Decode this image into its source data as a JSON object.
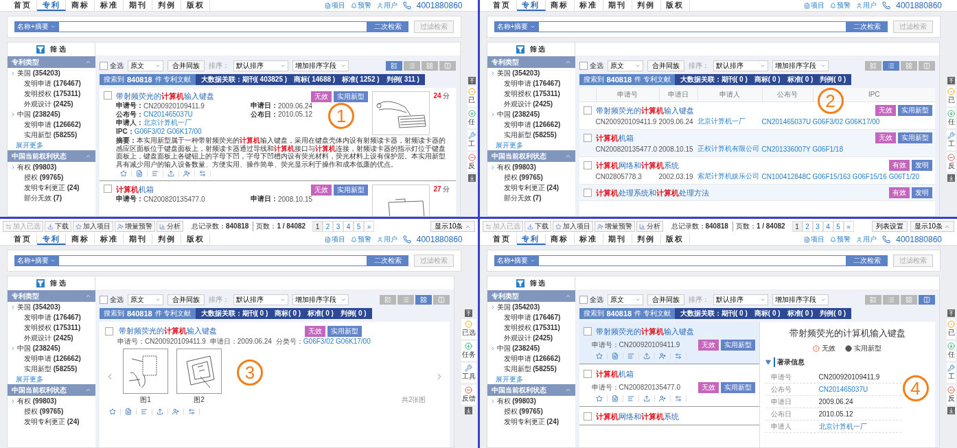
{
  "panels": [
    {
      "marker": "1",
      "nav": {
        "tabs": [
          {
            "label": "首页",
            "selected": false
          },
          {
            "label": "专利",
            "selected": true
          },
          {
            "label": "商标",
            "selected": false
          },
          {
            "label": "标准",
            "selected": false
          },
          {
            "label": "期刊",
            "selected": false
          },
          {
            "label": "判例",
            "selected": false
          },
          {
            "label": "版权",
            "selected": false
          }
        ],
        "links": [
          "项目",
          "预警",
          "用户"
        ],
        "phone": "4001880860"
      },
      "search": {
        "field": "名称+摘要",
        "button": "二次检索",
        "filter": {
          "label": "过滤检索",
          "disabled": true
        }
      },
      "filter_title": "筛 选",
      "sidebar": [
        {
          "title": "专利类型",
          "items": [
            {
              "label": "美国",
              "count": "(354203)",
              "children": [
                {
                  "label": "发明申请",
                  "count": "(176467)"
                },
                {
                  "label": "发明授权",
                  "count": "(175311)"
                },
                {
                  "label": "外观设计",
                  "count": "(2425)"
                }
              ]
            },
            {
              "label": "中国",
              "count": "(238245)",
              "children": [
                {
                  "label": "发明申请",
                  "count": "(126662)"
                },
                {
                  "label": "实用新型",
                  "count": "(58255)"
                }
              ]
            }
          ],
          "more": "展开更多"
        },
        {
          "title": "中国当前权利状态",
          "items": [
            {
              "label": "有权",
              "count": "(99803)",
              "children": [
                {
                  "label": "授权",
                  "count": "(99765)"
                },
                {
                  "label": "发明专利更正",
                  "count": "(24)"
                },
                {
                  "label": "部分无效",
                  "count": "(7)"
                }
              ]
            }
          ]
        }
      ],
      "toolbar": {
        "select_all": {
          "label": "全选",
          "checked": false
        },
        "source": "原文",
        "merge": "合并同族",
        "sort_label": "排序：",
        "sort": "默认排序",
        "add_sort": "增加排序字段",
        "views": [
          {
            "selected": true
          },
          {
            "selected": false
          },
          {
            "selected": false
          },
          {
            "selected": false
          }
        ]
      },
      "summary": {
        "found_label": "搜索到",
        "found": "840818",
        "found_unit": "件 专利文献",
        "related_label": "大数据关联：",
        "related": [
          "期刊( 403825 )",
          "商标( 14688 )",
          "标准( 1252 )",
          "判例( 311 )"
        ]
      },
      "results": [
        {
          "title": "带射频荧光的**计算机**输入键盘",
          "checked": false,
          "tags": [
            {
              "label": "无效",
              "kind": "status"
            },
            {
              "label": "实用新型",
              "kind": "type"
            }
          ],
          "fields": [
            {
              "label": "申请号：",
              "value": "CN200920109411.9",
              "link": false
            },
            {
              "label": "公布号：",
              "value": "CN201465037U",
              "link": true
            },
            {
              "label": "申请人：",
              "value": "北京计算机一厂",
              "link": true
            },
            {
              "label": "IPC：",
              "value": "G06F3/02  G06K17/00",
              "link": true
            }
          ],
          "fields_right": [
            {
              "label": "申请日：",
              "value": "2009.06.24",
              "link": false
            },
            {
              "label": "公布日：",
              "value": "2010.05.12",
              "link": false
            }
          ],
          "abstract_label": "摘要：",
          "abstract": "本实用新型属于一种带射频荧光的**计算机**输入键盘，采用在键盘壳体内设有射频读卡器，射频读卡器的感应区面板位于键盘面板上，射频读卡器通过导线和**计算机**接口与**计算机**连接，射频读卡器的指示灯位于键盘面板上，键盘面板上各键钮上的字母下凹，字母下凹槽内设有荧光材料，荧光材料上设有保护层。本实用新型具有减少用户的输入设备数量、方便实用、操作简单、荧光显示利于操作和成本低廉的优点。",
          "score": "24",
          "score_unit": "分"
        },
        {
          "title": "**计算机**机箱",
          "checked": false,
          "tags": [
            {
              "label": "无效",
              "kind": "status"
            },
            {
              "label": "实用新型",
              "kind": "type"
            }
          ],
          "fields": [
            {
              "label": "申请号：",
              "value": "CN200820135477.0",
              "link": false
            }
          ],
          "fields_right": [
            {
              "label": "申请日：",
              "value": "2008.10.15",
              "link": false
            }
          ],
          "score": "27",
          "score_unit": "分"
        }
      ],
      "side_tabs": [
        "已",
        "任",
        "工",
        "反"
      ]
    },
    {
      "marker": "2",
      "nav": {
        "tabs": [
          {
            "label": "首页",
            "selected": false
          },
          {
            "label": "专利",
            "selected": true
          },
          {
            "label": "商标",
            "selected": false
          },
          {
            "label": "标准",
            "selected": false
          },
          {
            "label": "期刊",
            "selected": false
          },
          {
            "label": "判例",
            "selected": false
          },
          {
            "label": "版权",
            "selected": false
          }
        ],
        "links": [
          "项目",
          "预警",
          "用户"
        ],
        "phone": "4001880860"
      },
      "search": {
        "field": "名称+摘要",
        "button": "二次检索",
        "filter": {
          "label": "过滤检索",
          "disabled": true
        }
      },
      "filter_title": "筛 选",
      "sidebar": [
        {
          "title": "专利类型",
          "items": [
            {
              "label": "美国",
              "count": "(354203)",
              "children": [
                {
                  "label": "发明申请",
                  "count": "(176467)"
                },
                {
                  "label": "发明授权",
                  "count": "(175311)"
                },
                {
                  "label": "外观设计",
                  "count": "(2425)"
                }
              ]
            },
            {
              "label": "中国",
              "count": "(238245)",
              "children": [
                {
                  "label": "发明申请",
                  "count": "(126662)"
                },
                {
                  "label": "实用新型",
                  "count": "(58255)"
                }
              ]
            }
          ],
          "more": "展开更多"
        },
        {
          "title": "中国当前权利状态",
          "items": [
            {
              "label": "有权",
              "count": "(99803)",
              "children": [
                {
                  "label": "授权",
                  "count": "(99765)"
                },
                {
                  "label": "发明专利更正",
                  "count": "(24)"
                },
                {
                  "label": "部分无效",
                  "count": "(7)"
                }
              ]
            }
          ]
        }
      ],
      "toolbar": {
        "select_all": {
          "label": "全选",
          "checked": false
        },
        "source": "原文",
        "merge": "合并同族",
        "sort_label": "排序：",
        "sort": "默认排序",
        "add_sort": "增加排序字段",
        "views": [
          {
            "selected": false
          },
          {
            "selected": true
          },
          {
            "selected": false
          },
          {
            "selected": false
          }
        ]
      },
      "summary": {
        "found_label": "搜索到",
        "found": "840818",
        "found_unit": "件 专利文献",
        "related_label": "大数据关联：",
        "related": [
          "期刊( 0 )",
          "商标( 0 )",
          "标准( 0 )",
          "判例( 0 )"
        ]
      },
      "columns": [
        "申请号",
        "申请日",
        "申请人",
        "公布号",
        "IPC"
      ],
      "results": [
        {
          "title": "带射频荧光的**计算机**输入键盘",
          "checked": false,
          "tags": [
            {
              "label": "无效",
              "kind": "status"
            },
            {
              "label": "实用新型",
              "kind": "type"
            }
          ],
          "cells": [
            {
              "text": "CN200920109411.9",
              "link": false
            },
            {
              "text": "2009.06.24",
              "link": false
            },
            {
              "text": "北京计算机一厂",
              "link": true
            },
            {
              "text": "CN201465037U",
              "link": true
            },
            {
              "text": "G06F3/02  G06K17/00",
              "link": true
            }
          ]
        },
        {
          "title": "**计算机**机箱",
          "checked": false,
          "tags": [
            {
              "label": "无效",
              "kind": "status"
            },
            {
              "label": "实用新型",
              "kind": "type"
            }
          ],
          "cells": [
            {
              "text": "CN200820135477.0",
              "link": false
            },
            {
              "text": "2008.10.15",
              "link": false
            },
            {
              "text": "正权计算机有限公司",
              "link": true
            },
            {
              "text": "CN201336007Y",
              "link": true
            },
            {
              "text": "G06F1/18",
              "link": true
            }
          ]
        },
        {
          "title": "**计算机**网络和**计算机**系统",
          "checked": false,
          "tags": [
            {
              "label": "有效",
              "kind": "status"
            },
            {
              "label": "发明",
              "kind": "type"
            }
          ],
          "cells": [
            {
              "text": "CN02805778.3",
              "link": false
            },
            {
              "text": "2002.03.19",
              "link": false
            },
            {
              "text": "索尼计算机娱乐公司",
              "link": true
            },
            {
              "text": "CN100412848C",
              "link": true
            },
            {
              "text": "G06F15/163  G06F15/16  G06T1/20",
              "link": true
            }
          ]
        },
        {
          "title": "**计算机**处理系统和**计算机**处理方法",
          "checked": false,
          "tags": [
            {
              "label": "有效",
              "kind": "status"
            },
            {
              "label": "发明",
              "kind": "type"
            }
          ]
        }
      ],
      "side_tabs": [
        "已",
        "任",
        "工",
        "反"
      ]
    },
    {
      "marker": "3",
      "action_bar": {
        "buttons": [
          {
            "label": "加入已选",
            "disabled": true
          },
          {
            "label": "下载",
            "disabled": false
          },
          {
            "label": "加入项目",
            "disabled": false
          },
          {
            "label": "增量预警",
            "disabled": false
          },
          {
            "label": "分析",
            "disabled": false
          }
        ],
        "total_label": "总记录数：",
        "total": "840818",
        "pages_label": "页数：",
        "pages": "1 / 84082",
        "pagination": [
          {
            "label": "1",
            "selected": true
          },
          {
            "label": "2",
            "selected": false
          },
          {
            "label": "3",
            "selected": false
          },
          {
            "label": "4",
            "selected": false
          },
          {
            "label": "5",
            "selected": false
          },
          {
            "label": "»",
            "selected": false
          }
        ],
        "page_size": "显示10条"
      },
      "nav": {
        "tabs": [
          {
            "label": "首页",
            "selected": false
          },
          {
            "label": "专利",
            "selected": true
          },
          {
            "label": "商标",
            "selected": false
          },
          {
            "label": "标准",
            "selected": false
          },
          {
            "label": "期刊",
            "selected": false
          },
          {
            "label": "判例",
            "selected": false
          },
          {
            "label": "版权",
            "selected": false
          }
        ],
        "links": [
          "项目",
          "预警",
          "用户"
        ],
        "phone": "4001880860"
      },
      "search": {
        "field": "名称+摘要",
        "button": "二次检索",
        "filter": {
          "label": "过滤检索",
          "disabled": true
        }
      },
      "filter_title": "筛 选",
      "sidebar": [
        {
          "title": "专利类型",
          "items": [
            {
              "label": "美国",
              "count": "(354203)",
              "children": [
                {
                  "label": "发明申请",
                  "count": "(176467)"
                },
                {
                  "label": "发明授权",
                  "count": "(175311)"
                },
                {
                  "label": "外观设计",
                  "count": "(2425)"
                }
              ]
            },
            {
              "label": "中国",
              "count": "(238245)",
              "children": [
                {
                  "label": "发明申请",
                  "count": "(126662)"
                },
                {
                  "label": "实用新型",
                  "count": "(58255)"
                }
              ]
            }
          ],
          "more": "展开更多"
        },
        {
          "title": "中国当前权利状态",
          "items": [
            {
              "label": "有权",
              "count": "(99803)",
              "children": [
                {
                  "label": "授权",
                  "count": "(99765)"
                },
                {
                  "label": "发明专利更正",
                  "count": "(24)"
                }
              ]
            }
          ]
        }
      ],
      "toolbar": {
        "select_all": {
          "label": "全选",
          "checked": false
        },
        "source": "原文",
        "merge": "合并同族",
        "sort_label": "排序：",
        "sort": "默认排序",
        "add_sort": "增加排序字段",
        "views": [
          {
            "selected": false
          },
          {
            "selected": false
          },
          {
            "selected": true
          },
          {
            "selected": false
          }
        ]
      },
      "summary": {
        "found_label": "搜索到",
        "found": "840818",
        "found_unit": "件 专利文献",
        "related_label": "大数据关联：",
        "related": [
          "期刊( 0 )",
          "商标( 0 )",
          "标准( 0 )",
          "判例( 0 )"
        ]
      },
      "results": [
        {
          "title": "带射频荧光的**计算机**输入键盘",
          "checked": false,
          "tags": [
            {
              "label": "无效",
              "kind": "status"
            },
            {
              "label": "实用新型",
              "kind": "type"
            }
          ],
          "info": [
            {
              "label": "申请号：",
              "value": "CN200920109411.9",
              "link": false
            },
            {
              "label": "申请日：",
              "value": "2009.06.24",
              "link": false
            },
            {
              "label": "分类号：",
              "value": "G06F3/02  G06K17/00",
              "link": true
            }
          ],
          "figures": [
            "图1",
            "图2"
          ],
          "figure_count": "共2张图"
        }
      ],
      "side_tabs": [
        "已选",
        "任务",
        "工具",
        "反馈"
      ]
    },
    {
      "marker": "4",
      "action_bar": {
        "buttons": [
          {
            "label": "加入已选",
            "disabled": true
          },
          {
            "label": "下载",
            "disabled": false
          },
          {
            "label": "加入项目",
            "disabled": false
          },
          {
            "label": "增量预警",
            "disabled": false
          },
          {
            "label": "分析",
            "disabled": false
          }
        ],
        "total_label": "总记录数：",
        "total": "840818",
        "pages_label": "页数：",
        "pages": "1 / 84082",
        "pagination": [
          {
            "label": "1",
            "selected": true
          },
          {
            "label": "2",
            "selected": false
          },
          {
            "label": "3",
            "selected": false
          },
          {
            "label": "4",
            "selected": false
          },
          {
            "label": "5",
            "selected": false
          },
          {
            "label": "»",
            "selected": false
          }
        ],
        "settings": "列表设置",
        "page_size": "显示10条"
      },
      "nav": {
        "tabs": [
          {
            "label": "首页",
            "selected": false
          },
          {
            "label": "专利",
            "selected": true
          },
          {
            "label": "商标",
            "selected": false
          },
          {
            "label": "标准",
            "selected": false
          },
          {
            "label": "期刊",
            "selected": false
          },
          {
            "label": "判例",
            "selected": false
          },
          {
            "label": "版权",
            "selected": false
          }
        ],
        "links": [
          "项目",
          "预警",
          "用户"
        ],
        "phone": "4001880860"
      },
      "search": {
        "field": "名称+摘要",
        "button": "二次检索",
        "filter": {
          "label": "过滤检索",
          "disabled": true
        }
      },
      "filter_title": "筛 选",
      "sidebar": [
        {
          "title": "专利类型",
          "items": [
            {
              "label": "美国",
              "count": "(354203)",
              "children": [
                {
                  "label": "发明申请",
                  "count": "(176467)"
                },
                {
                  "label": "发明授权",
                  "count": "(175311)"
                },
                {
                  "label": "外观设计",
                  "count": "(2425)"
                }
              ]
            },
            {
              "label": "中国",
              "count": "(238245)",
              "children": [
                {
                  "label": "发明申请",
                  "count": "(126662)"
                },
                {
                  "label": "实用新型",
                  "count": "(58255)"
                }
              ]
            }
          ],
          "more": "展开更多"
        },
        {
          "title": "中国当前权利状态",
          "items": [
            {
              "label": "有权",
              "count": "(99803)",
              "children": [
                {
                  "label": "授权",
                  "count": "(99765)"
                },
                {
                  "label": "发明专利更正",
                  "count": "(24)"
                }
              ]
            }
          ]
        }
      ],
      "toolbar": {
        "select_all": {
          "label": "全选",
          "checked": false
        },
        "source": "原文",
        "merge": "合并同族",
        "sort_label": "排序：",
        "sort": "默认排序",
        "add_sort": "增加排序字段",
        "views": [
          {
            "selected": false
          },
          {
            "selected": false
          },
          {
            "selected": false
          },
          {
            "selected": true
          }
        ]
      },
      "summary": {
        "found_label": "搜索到",
        "found": "840818",
        "found_unit": "件 专利文献",
        "related_label": "大数据关联：",
        "related": [
          "期刊( 0 )",
          "商标( 0 )",
          "标准( 0 )",
          "判例( 0 )"
        ]
      },
      "results": [
        {
          "title": "带射频荧光的**计算机**输入键盘",
          "checked": false,
          "selected": true,
          "field": {
            "label": "申请号：",
            "value": "CN200920109411.9"
          },
          "tags": [
            {
              "label": "无效",
              "kind": "status"
            },
            {
              "label": "实用新型",
              "kind": "type"
            }
          ]
        },
        {
          "title": "**计算机**机箱",
          "checked": false,
          "selected": false,
          "field": {
            "label": "申请号：",
            "value": "CN200820135477.0"
          },
          "tags": [
            {
              "label": "无效",
              "kind": "status"
            },
            {
              "label": "实用新型",
              "kind": "type"
            }
          ]
        },
        {
          "title": "**计算机**网络和**计算机**系统",
          "checked": false,
          "selected": false
        }
      ],
      "detail": {
        "title": "带射频荧光的计算机输入键盘",
        "statuses": [
          {
            "label": "无效",
            "kind": "invalid"
          },
          {
            "label": "实用新型",
            "kind": "type"
          }
        ],
        "section": "著录信息",
        "rows": [
          {
            "label": "申请号",
            "value": "CN200920109411.9",
            "link": false
          },
          {
            "label": "公布号",
            "value": "CN201465037U",
            "link": true
          },
          {
            "label": "申请日",
            "value": "2009.06.24",
            "link": false
          },
          {
            "label": "公布日",
            "value": "2010.05.12",
            "link": false
          },
          {
            "label": "申请人",
            "value": "北京计算机一厂",
            "link": true
          }
        ]
      },
      "side_tabs": [
        "已",
        "任",
        "工",
        "反"
      ]
    }
  ]
}
